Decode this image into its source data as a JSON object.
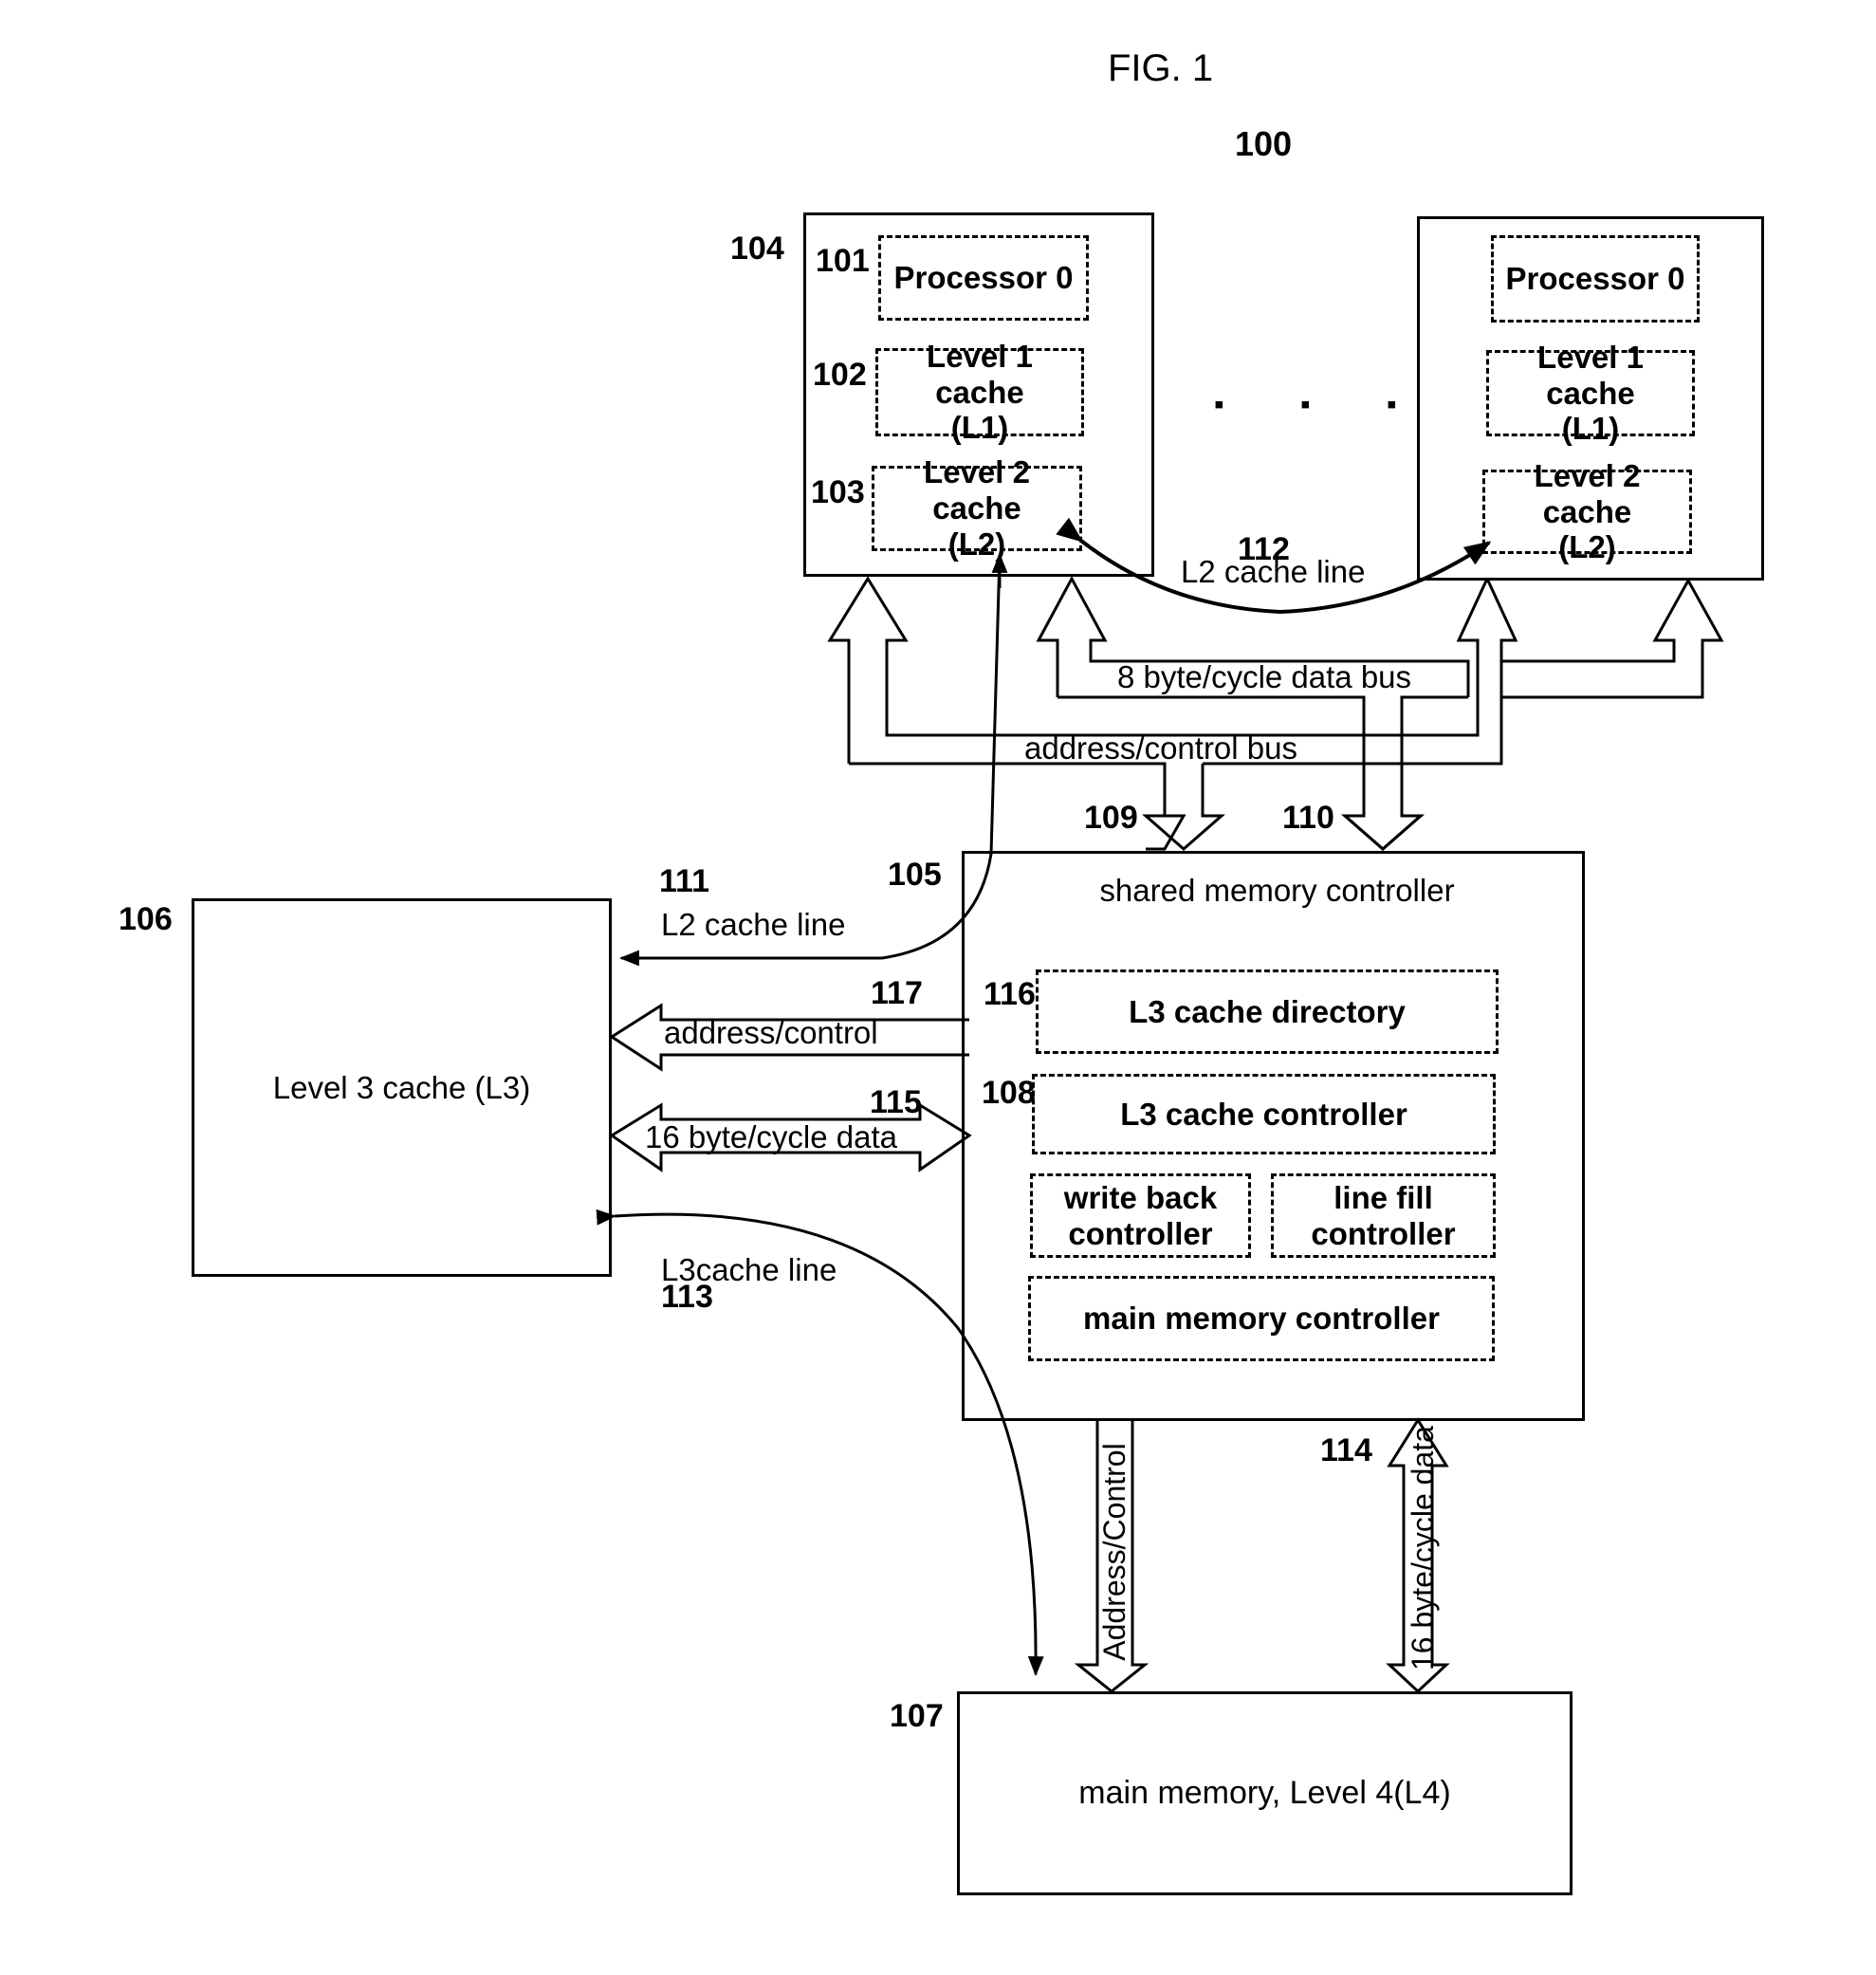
{
  "figure": {
    "title": "FIG. 1",
    "ref": "100"
  },
  "processor_groups": [
    {
      "ref": "104",
      "processor": {
        "ref": "101",
        "label": "Processor 0"
      },
      "l1": {
        "ref": "102",
        "label": "Level 1 cache (L1)"
      },
      "l2": {
        "ref": "103",
        "label": "Level 2 cache (L2)"
      }
    },
    {
      "processor": {
        "label": "Processor 0"
      },
      "l1": {
        "label": "Level 1 cache (L1)"
      },
      "l2": {
        "label": "Level 2 cache (L2)"
      }
    }
  ],
  "ellipsis": "▪ ▪ ▪",
  "buses": {
    "l2_transfer": {
      "ref": "112",
      "label": "L2 cache line"
    },
    "data_bus": {
      "label": "8 byte/cycle data bus"
    },
    "address_bus": {
      "label": "address/control bus"
    },
    "addr_to_controller": {
      "ref": "109"
    },
    "data_to_controller": {
      "ref": "110"
    },
    "l2_to_l3": {
      "ref": "111",
      "label": "L2 cache line",
      "link_ref": "105"
    },
    "l3_address": {
      "ref": "117",
      "label": "address/control"
    },
    "l3_data": {
      "ref": "115",
      "label": "16 byte/cycle data"
    },
    "l3_to_memory": {
      "ref": "113",
      "label": "L3cache line"
    },
    "mem_address": {
      "label": "Address/Control"
    },
    "mem_data": {
      "ref": "114",
      "label": "16 byte/cycle data"
    }
  },
  "l3_cache": {
    "ref": "106",
    "label": "Level 3 cache (L3)"
  },
  "controller": {
    "title": "shared memory controller",
    "directory": {
      "ref": "116",
      "label": "L3 cache directory"
    },
    "l3_controller": {
      "ref": "108",
      "label": "L3 cache controller"
    },
    "write_back": {
      "label": "write back controller"
    },
    "line_fill": {
      "label": "line fill controller"
    },
    "main_memory_controller": {
      "label": "main memory controller"
    }
  },
  "main_memory": {
    "ref": "107",
    "label": "main memory, Level 4(L4)"
  }
}
